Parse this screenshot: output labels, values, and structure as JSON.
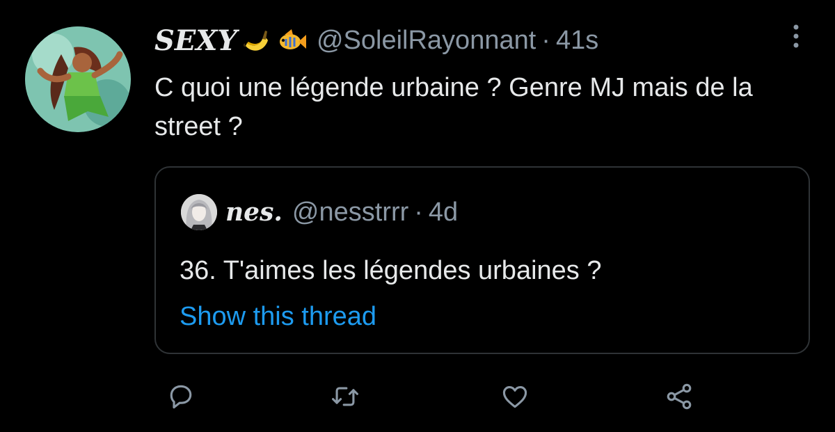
{
  "tweet": {
    "display_name": "SEXY",
    "emojis": [
      "banana-emoji",
      "fish-emoji"
    ],
    "handle": "@SoleilRayonnant",
    "separator": "·",
    "time": "41s",
    "text": "C quoi une légende urbaine ? Genre MJ mais de la street ?",
    "more_icon": "more-vertical-icon"
  },
  "quoted_tweet": {
    "display_name": "nes.",
    "handle": "@nesstrrr",
    "separator": "·",
    "time": "4d",
    "text": "36. T'aimes les légendes urbaines ?",
    "show_thread_label": "Show this thread"
  },
  "actions": [
    {
      "icon": "reply-icon"
    },
    {
      "icon": "retweet-icon"
    },
    {
      "icon": "like-icon"
    },
    {
      "icon": "share-icon"
    }
  ],
  "colors": {
    "background": "#000000",
    "text": "#e7e9ea",
    "secondary": "#8b98a5",
    "link": "#1d9bf0",
    "border": "#2f3336"
  }
}
